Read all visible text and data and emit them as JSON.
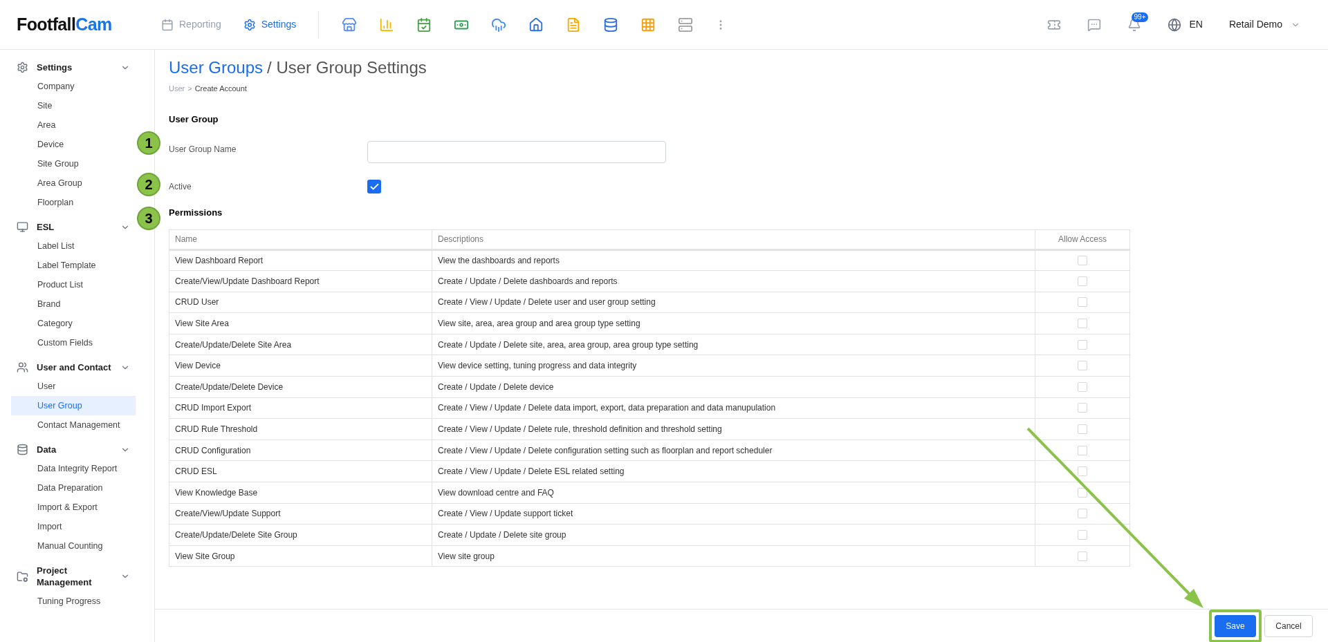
{
  "logo": {
    "first": "Footfall",
    "second": "Cam"
  },
  "nav": [
    {
      "label": "Reporting",
      "selected": false
    },
    {
      "label": "Settings",
      "selected": true
    }
  ],
  "notifications": {
    "badge": "99+"
  },
  "language": "EN",
  "account": "Retail Demo",
  "sidebar": [
    {
      "title": "Settings",
      "expanded": true,
      "items": [
        {
          "label": "Company",
          "selected": false
        },
        {
          "label": "Site",
          "selected": false
        },
        {
          "label": "Area",
          "selected": false
        },
        {
          "label": "Device",
          "selected": false
        },
        {
          "label": "Site Group",
          "selected": false
        },
        {
          "label": "Area Group",
          "selected": false
        },
        {
          "label": "Floorplan",
          "selected": false
        }
      ]
    },
    {
      "title": "ESL",
      "expanded": true,
      "items": [
        {
          "label": "Label List",
          "selected": false
        },
        {
          "label": "Label Template",
          "selected": false
        },
        {
          "label": "Product List",
          "selected": false
        },
        {
          "label": "Brand",
          "selected": false
        },
        {
          "label": "Category",
          "selected": false
        },
        {
          "label": "Custom Fields",
          "selected": false
        }
      ]
    },
    {
      "title": "User and Contact",
      "expanded": true,
      "items": [
        {
          "label": "User",
          "selected": false
        },
        {
          "label": "User Group",
          "selected": true
        },
        {
          "label": "Contact Management",
          "selected": false
        }
      ]
    },
    {
      "title": "Data",
      "expanded": true,
      "items": [
        {
          "label": "Data Integrity Report",
          "selected": false
        },
        {
          "label": "Data Preparation",
          "selected": false
        },
        {
          "label": "Import & Export",
          "selected": false
        },
        {
          "label": "Import",
          "selected": false
        },
        {
          "label": "Manual Counting",
          "selected": false
        }
      ]
    },
    {
      "title": "Project Management",
      "expanded": true,
      "items": [
        {
          "label": "Tuning Progress",
          "selected": false
        }
      ]
    }
  ],
  "page": {
    "title_link": "User Groups",
    "title_rest": "/ User Group Settings",
    "breadcrumb": {
      "parent": "User",
      "separator": ">",
      "current": "Create Account"
    }
  },
  "form": {
    "section": "User Group",
    "name_label": "User Group Name",
    "active_label": "Active",
    "active_checked": true,
    "permissions_label": "Permissions"
  },
  "annotations": [
    "1",
    "2",
    "3"
  ],
  "table": {
    "columns": [
      "Name",
      "Descriptions",
      "Allow Access"
    ],
    "rows": [
      {
        "name": "View Dashboard Report",
        "description": "View the dashboards and reports",
        "checked": false
      },
      {
        "name": "Create/View/Update Dashboard Report",
        "description": "Create / Update / Delete dashboards and reports",
        "checked": false
      },
      {
        "name": "CRUD User",
        "description": "Create / View / Update / Delete user and user group setting",
        "checked": false
      },
      {
        "name": "View Site Area",
        "description": "View site, area, area group and area group type setting",
        "checked": false
      },
      {
        "name": "Create/Update/Delete Site Area",
        "description": "Create / Update / Delete site, area, area group, area group type setting",
        "checked": false
      },
      {
        "name": "View Device",
        "description": "View device setting, tuning progress and data integrity",
        "checked": false
      },
      {
        "name": "Create/Update/Delete Device",
        "description": "Create / Update / Delete device",
        "checked": false
      },
      {
        "name": "CRUD Import Export",
        "description": "Create / View / Update / Delete data import, export, data preparation and data manupulation",
        "checked": false
      },
      {
        "name": "CRUD Rule Threshold",
        "description": "Create / View / Update / Delete rule, threshold definition and threshold setting",
        "checked": false
      },
      {
        "name": "CRUD Configuration",
        "description": "Create / View / Update / Delete configuration setting such as floorplan and report scheduler",
        "checked": false
      },
      {
        "name": "CRUD ESL",
        "description": "Create / View / Update / Delete ESL related setting",
        "checked": false
      },
      {
        "name": "View Knowledge Base",
        "description": "View download centre and FAQ",
        "checked": false
      },
      {
        "name": "Create/View/Update Support",
        "description": "Create / View / Update support ticket",
        "checked": false
      },
      {
        "name": "Create/Update/Delete Site Group",
        "description": "Create / Update / Delete site group",
        "checked": false
      },
      {
        "name": "View Site Group",
        "description": "View site group",
        "checked": false
      }
    ]
  },
  "footer": {
    "save": "Save",
    "cancel": "Cancel",
    "save_highlighted": true
  }
}
